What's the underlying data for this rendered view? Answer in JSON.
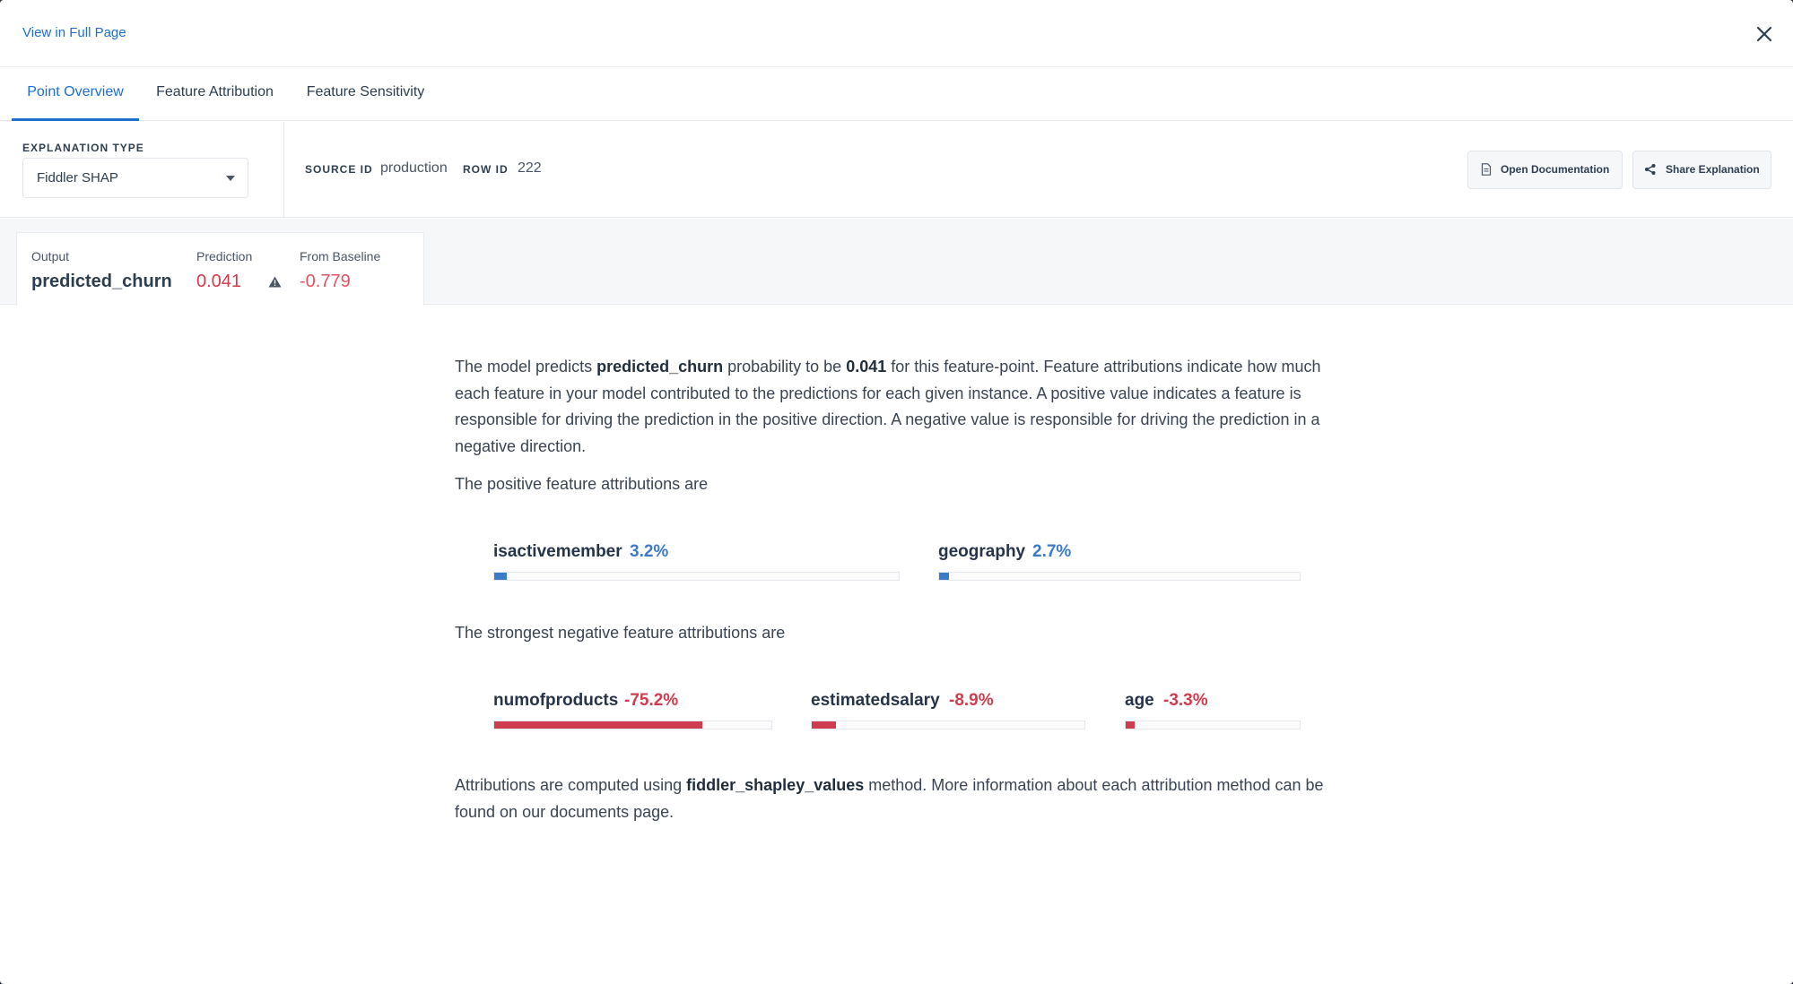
{
  "header": {
    "full_page_link": "View in Full Page"
  },
  "tabs": [
    {
      "label": "Point Overview",
      "active": true
    },
    {
      "label": "Feature Attribution",
      "active": false
    },
    {
      "label": "Feature Sensitivity",
      "active": false
    }
  ],
  "controls": {
    "explanation_type_label": "EXPLANATION TYPE",
    "explanation_type_value": "Fiddler SHAP",
    "source_id_label": "SOURCE ID",
    "source_id_value": "production",
    "row_id_label": "ROW ID",
    "row_id_value": "222",
    "open_docs_label": "Open Documentation",
    "share_label": "Share Explanation"
  },
  "summary": {
    "output_label": "Output",
    "output_value": "predicted_churn",
    "prediction_label": "Prediction",
    "prediction_value": "0.041",
    "baseline_label": "From Baseline",
    "baseline_value": "-0.779"
  },
  "explanation": {
    "intro_prefix": "The model predicts ",
    "intro_output": "predicted_churn",
    "intro_mid": " probability to be ",
    "intro_value": "0.041",
    "intro_suffix": " for this feature-point. Feature attributions indicate how much",
    "line2": "each feature in your model contributed to the predictions for each given instance. A positive value indicates a feature is",
    "line3": "responsible for driving the prediction in the positive direction. A negative value is responsible for driving the prediction in a",
    "line4": "negative direction.",
    "positive_title": "The positive feature attributions are",
    "negative_title": "The strongest negative feature attributions are",
    "footer_prefix": "Attributions are computed using ",
    "footer_method": "fiddler_shapley_values",
    "footer_suffix": " method. More information about each attribution method can be",
    "footer_line2": "found on our documents page."
  },
  "positive_attributions": [
    {
      "feature": "isactivemember",
      "value_text": "3.2%",
      "fraction": 0.032
    },
    {
      "feature": "geography",
      "value_text": "2.7%",
      "fraction": 0.027
    }
  ],
  "negative_attributions": [
    {
      "feature": "numofproducts",
      "value_text": "-75.2%",
      "fraction": 0.752
    },
    {
      "feature": "estimatedsalary",
      "value_text": "-8.9%",
      "fraction": 0.089
    },
    {
      "feature": "age",
      "value_text": "-3.3%",
      "fraction": 0.033
    }
  ],
  "colors": {
    "accent": "#1f6fd0",
    "positive": "#3b7bc8",
    "negative": "#cf3c4f"
  },
  "icons": {
    "close": "close-icon",
    "caret": "caret-down-icon",
    "warning": "warning-icon",
    "document": "document-icon",
    "share": "share-icon"
  }
}
